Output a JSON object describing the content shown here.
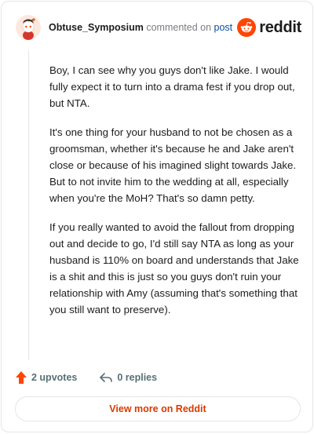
{
  "header": {
    "username": "Obtuse_Symposium",
    "commented_text": "commented on",
    "post_link": "post",
    "brand": "reddit"
  },
  "comment": {
    "paragraphs": [
      "Boy, I can see why you guys don't like Jake. I would fully expect it to turn into a drama fest if you drop out, but NTA.",
      "It's one thing for your husband to not be chosen as a groomsman, whether it's because he and Jake aren't close or because of his imagined slight towards Jake. But to not invite him to the wedding at all, especially when you're the MoH? That's so damn petty.",
      "If you really wanted to avoid the fallout from dropping out and decide to go, I'd still say NTA as long as your husband is 110% on board and understands that Jake is a shit and this is just so you guys don't ruin your relationship with Amy (assuming that's something that you still want to preserve)."
    ]
  },
  "actions": {
    "upvotes": "2 upvotes",
    "replies": "0 replies"
  },
  "footer": {
    "view_more": "View more on Reddit"
  },
  "colors": {
    "brand_orange": "#ff4500",
    "upvote": "#ff4500",
    "link_blue": "#0a4ea3",
    "view_more_text": "#d93a00"
  },
  "icons": {
    "avatar": "snoo-avatar",
    "brand_logo": "reddit-logo-icon",
    "upvote": "upvote-arrow-icon",
    "reply": "reply-arrow-icon"
  }
}
